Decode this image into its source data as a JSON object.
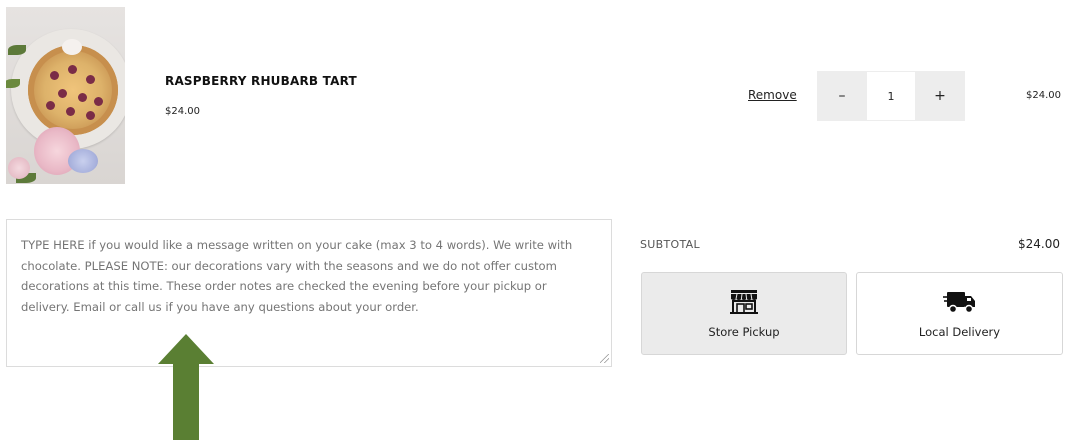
{
  "cart": {
    "item": {
      "title": "RASPBERRY RHUBARB TART",
      "price": "$24.00",
      "remove_label": "Remove",
      "quantity": "1",
      "decrement_label": "–",
      "increment_label": "+",
      "line_total": "$24.00"
    }
  },
  "notes": {
    "placeholder": "TYPE HERE if you would like a message written on your cake (max 3 to 4 words). We write with chocolate. PLEASE NOTE: our decorations vary with the seasons and we do not offer custom decorations at this time. These order notes are checked the evening before your pickup or delivery. Email or call us if you have any questions about your order."
  },
  "summary": {
    "subtotal_label": "SUBTOTAL",
    "subtotal_value": "$24.00"
  },
  "fulfillment": {
    "pickup_label": "Store Pickup",
    "delivery_label": "Local Delivery",
    "pickup_icon": "storefront-icon",
    "delivery_icon": "delivery-truck-icon",
    "selected_bg": "#ebebeb"
  },
  "annotation": {
    "arrow_color": "#5a7f33",
    "arrow_direction": "up"
  }
}
